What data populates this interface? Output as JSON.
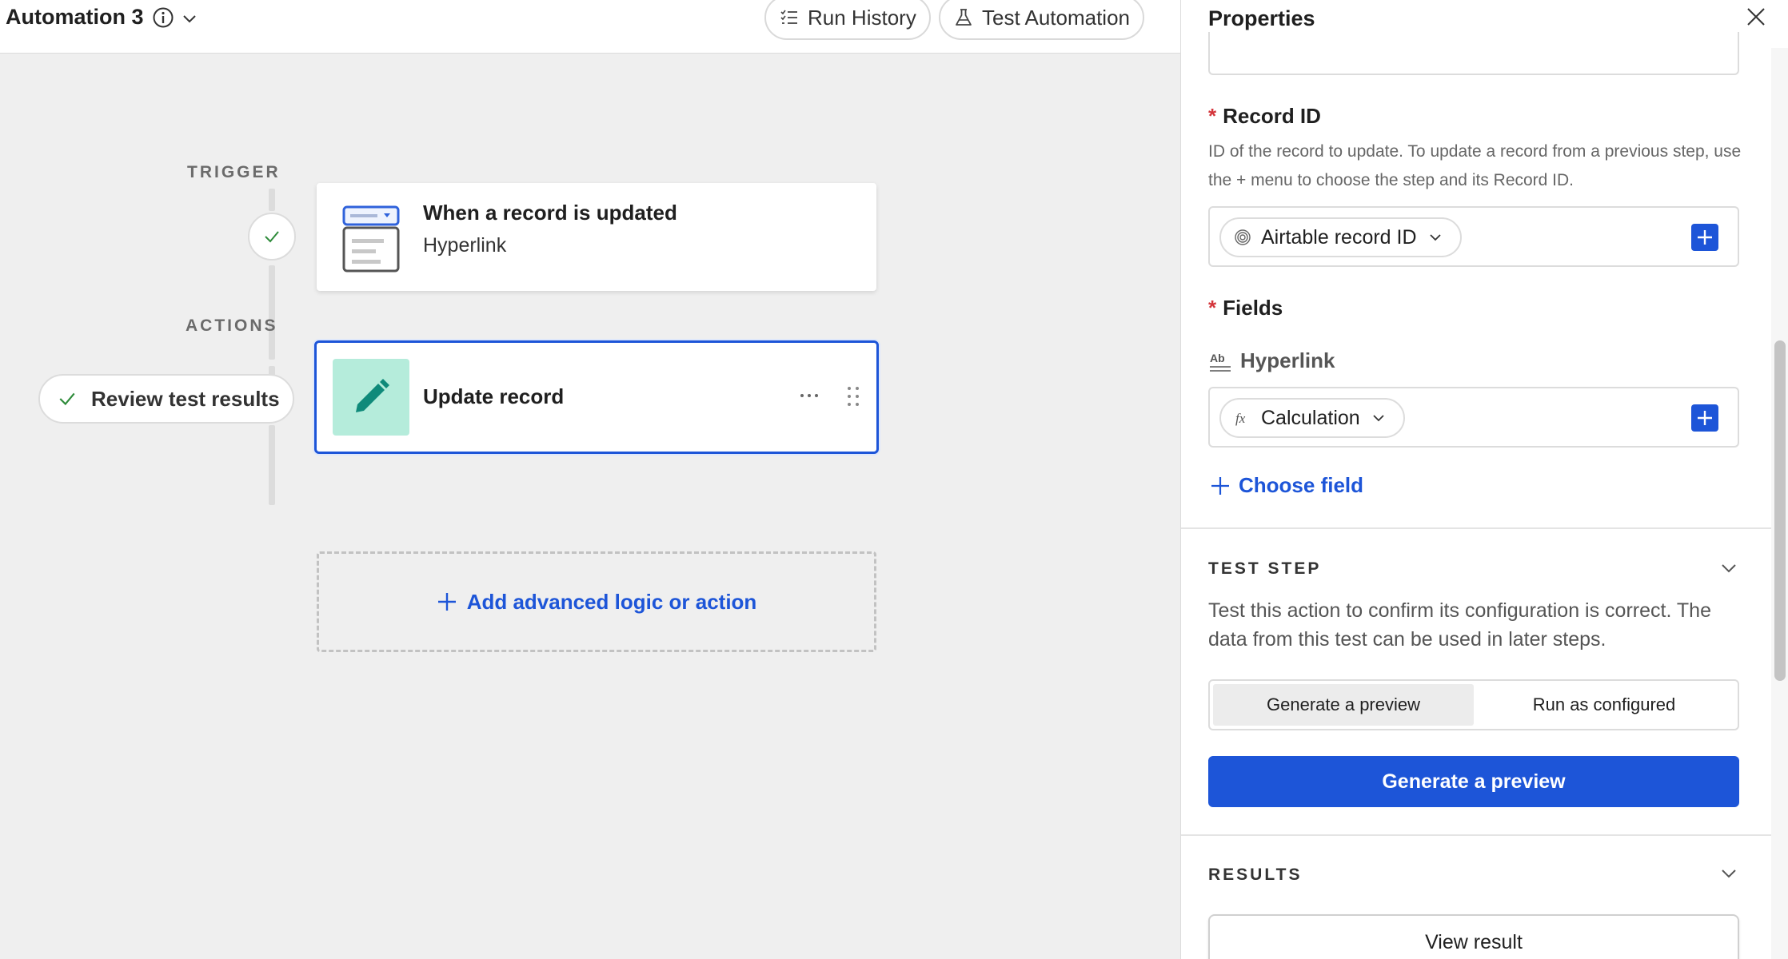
{
  "header": {
    "title": "Automation 3",
    "run_history_label": "Run History",
    "test_automation_label": "Test Automation"
  },
  "canvas": {
    "trigger_label": "TRIGGER",
    "actions_label": "ACTIONS",
    "review_label": "Review test results",
    "trigger_card": {
      "title": "When a record is updated",
      "subtitle": "Hyperlink"
    },
    "action_card": {
      "title": "Update record"
    },
    "add_action_label": "Add advanced logic or action"
  },
  "panel": {
    "title": "Properties",
    "record_id": {
      "label": "Record ID",
      "help": "ID of the record to update. To update a record from a previous step, use the + menu to choose the step and its Record ID.",
      "token": "Airtable record ID"
    },
    "fields": {
      "label": "Fields",
      "field_name": "Hyperlink",
      "token": "Calculation",
      "choose_label": "Choose field"
    },
    "test_step": {
      "heading": "TEST STEP",
      "description": "Test this action to confirm its configuration is correct. The data from this test can be used in later steps.",
      "tab_preview": "Generate a preview",
      "tab_configured": "Run as configured",
      "primary_button": "Generate a preview"
    },
    "results": {
      "heading": "RESULTS",
      "view_button": "View result"
    }
  },
  "colors": {
    "accent": "#1d55d8",
    "success": "#2e8b3a",
    "pencil_tile": "#b5ecdb",
    "pencil": "#0f8a7a",
    "required": "#d4353b"
  },
  "icons": [
    "info-icon",
    "chevron-down-icon",
    "list-icon",
    "flask-icon",
    "check-icon",
    "record-icon",
    "pencil-icon",
    "more-icon",
    "drag-handle-icon",
    "plus-icon",
    "close-icon",
    "fingerprint-icon",
    "text-field-icon",
    "formula-icon"
  ]
}
